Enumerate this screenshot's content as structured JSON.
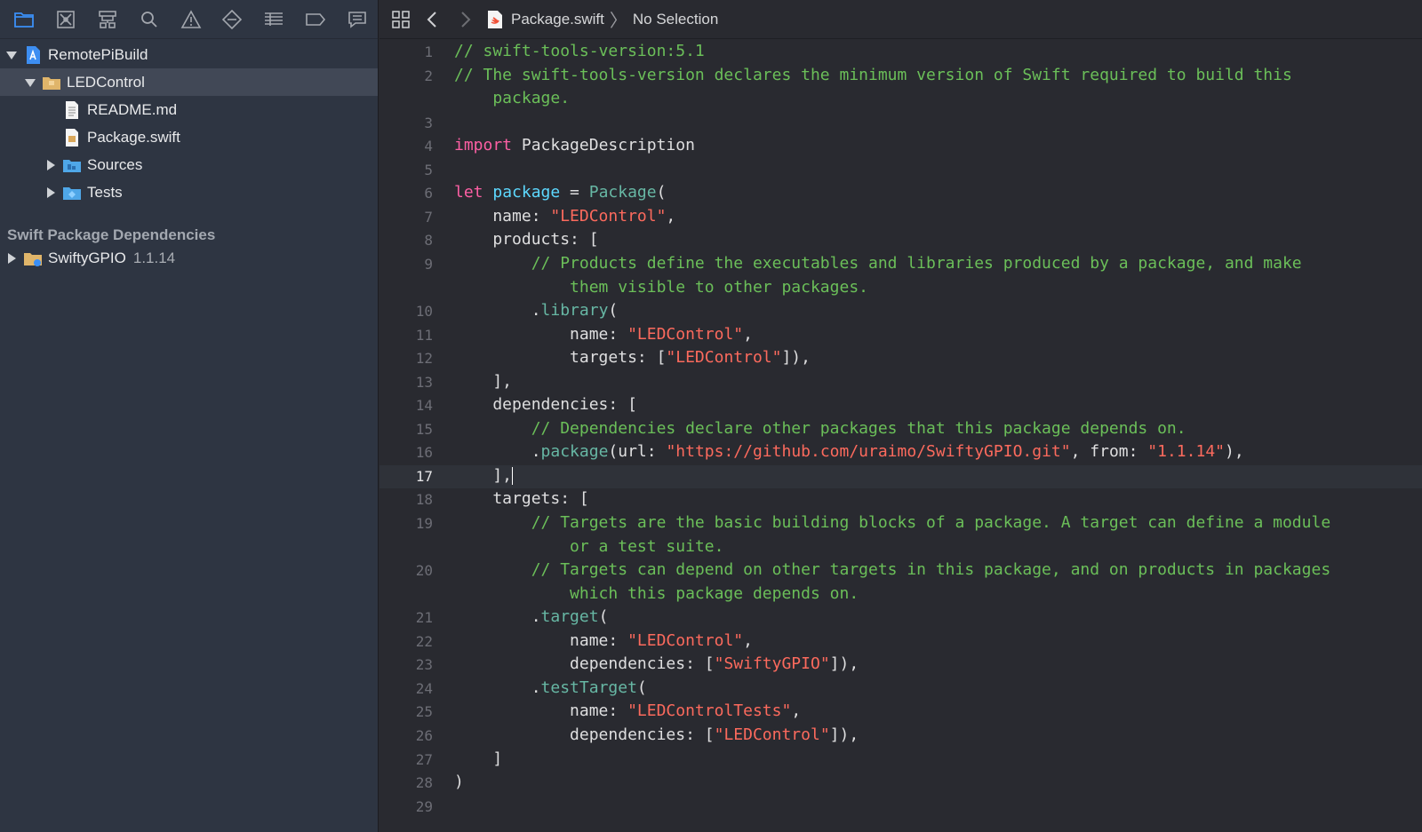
{
  "navigator": {
    "toolbar": [
      {
        "icon": "folder-icon",
        "active": true
      },
      {
        "icon": "source-control-icon"
      },
      {
        "icon": "hierarchy-icon"
      },
      {
        "icon": "search-icon"
      },
      {
        "icon": "warning-icon"
      },
      {
        "icon": "test-diamond-icon"
      },
      {
        "icon": "debug-list-icon"
      },
      {
        "icon": "breakpoint-tag-icon"
      },
      {
        "icon": "report-bubble-icon"
      }
    ],
    "project": "RemotePiBuild",
    "package_folder": "LEDControl",
    "files": [
      "README.md",
      "Package.swift"
    ],
    "folders": [
      "Sources",
      "Tests"
    ],
    "section_header": "Swift Package Dependencies",
    "dependency": {
      "name": "SwiftyGPIO",
      "version": "1.1.14"
    }
  },
  "jump_bar": {
    "file": "Package.swift",
    "selection": "No Selection"
  },
  "editor": {
    "current_line": 17,
    "lines": [
      {
        "n": "1",
        "parts": [
          {
            "c": "t-comment",
            "t": "// swift-tools-version:5.1"
          }
        ]
      },
      {
        "n": "2",
        "parts": [
          {
            "c": "t-comment",
            "t": "// The swift-tools-version declares the minimum version of Swift required to build this"
          }
        ]
      },
      {
        "n": "",
        "parts": [
          {
            "c": "t-comment",
            "t": "    package."
          }
        ]
      },
      {
        "n": "3",
        "parts": []
      },
      {
        "n": "4",
        "parts": [
          {
            "c": "t-keyword",
            "t": "import"
          },
          {
            "c": "",
            "t": " PackageDescription"
          }
        ]
      },
      {
        "n": "5",
        "parts": []
      },
      {
        "n": "6",
        "parts": [
          {
            "c": "t-keyword",
            "t": "let"
          },
          {
            "c": "",
            "t": " "
          },
          {
            "c": "t-decl",
            "t": "package"
          },
          {
            "c": "",
            "t": " = "
          },
          {
            "c": "t-func",
            "t": "Package"
          },
          {
            "c": "",
            "t": "("
          }
        ]
      },
      {
        "n": "7",
        "parts": [
          {
            "c": "",
            "t": "    name: "
          },
          {
            "c": "t-string",
            "t": "\"LEDControl\""
          },
          {
            "c": "",
            "t": ","
          }
        ]
      },
      {
        "n": "8",
        "parts": [
          {
            "c": "",
            "t": "    products: ["
          }
        ]
      },
      {
        "n": "9",
        "parts": [
          {
            "c": "t-comment",
            "t": "        // Products define the executables and libraries produced by a package, and make"
          }
        ]
      },
      {
        "n": "",
        "parts": [
          {
            "c": "t-comment",
            "t": "            them visible to other packages."
          }
        ]
      },
      {
        "n": "10",
        "parts": [
          {
            "c": "",
            "t": "        ."
          },
          {
            "c": "t-func",
            "t": "library"
          },
          {
            "c": "",
            "t": "("
          }
        ]
      },
      {
        "n": "11",
        "parts": [
          {
            "c": "",
            "t": "            name: "
          },
          {
            "c": "t-string",
            "t": "\"LEDControl\""
          },
          {
            "c": "",
            "t": ","
          }
        ]
      },
      {
        "n": "12",
        "parts": [
          {
            "c": "",
            "t": "            targets: ["
          },
          {
            "c": "t-string",
            "t": "\"LEDControl\""
          },
          {
            "c": "",
            "t": "]),"
          }
        ]
      },
      {
        "n": "13",
        "parts": [
          {
            "c": "",
            "t": "    ],"
          }
        ]
      },
      {
        "n": "14",
        "parts": [
          {
            "c": "",
            "t": "    dependencies: ["
          }
        ]
      },
      {
        "n": "15",
        "parts": [
          {
            "c": "t-comment",
            "t": "        // Dependencies declare other packages that this package depends on."
          }
        ]
      },
      {
        "n": "16",
        "parts": [
          {
            "c": "",
            "t": "        ."
          },
          {
            "c": "t-func",
            "t": "package"
          },
          {
            "c": "",
            "t": "(url: "
          },
          {
            "c": "t-string",
            "t": "\"https://github.com/uraimo/SwiftyGPIO.git\""
          },
          {
            "c": "",
            "t": ", from: "
          },
          {
            "c": "t-string",
            "t": "\"1.1.14\""
          },
          {
            "c": "",
            "t": "),"
          }
        ]
      },
      {
        "n": "17",
        "parts": [
          {
            "c": "",
            "t": "    ],"
          }
        ],
        "caret": true
      },
      {
        "n": "18",
        "parts": [
          {
            "c": "",
            "t": "    targets: ["
          }
        ]
      },
      {
        "n": "19",
        "parts": [
          {
            "c": "t-comment",
            "t": "        // Targets are the basic building blocks of a package. A target can define a module"
          }
        ]
      },
      {
        "n": "",
        "parts": [
          {
            "c": "t-comment",
            "t": "            or a test suite."
          }
        ]
      },
      {
        "n": "20",
        "parts": [
          {
            "c": "t-comment",
            "t": "        // Targets can depend on other targets in this package, and on products in packages"
          }
        ]
      },
      {
        "n": "",
        "parts": [
          {
            "c": "t-comment",
            "t": "            which this package depends on."
          }
        ]
      },
      {
        "n": "21",
        "parts": [
          {
            "c": "",
            "t": "        ."
          },
          {
            "c": "t-func",
            "t": "target"
          },
          {
            "c": "",
            "t": "("
          }
        ]
      },
      {
        "n": "22",
        "parts": [
          {
            "c": "",
            "t": "            name: "
          },
          {
            "c": "t-string",
            "t": "\"LEDControl\""
          },
          {
            "c": "",
            "t": ","
          }
        ]
      },
      {
        "n": "23",
        "parts": [
          {
            "c": "",
            "t": "            dependencies: ["
          },
          {
            "c": "t-string",
            "t": "\"SwiftyGPIO\""
          },
          {
            "c": "",
            "t": "]),"
          }
        ]
      },
      {
        "n": "24",
        "parts": [
          {
            "c": "",
            "t": "        ."
          },
          {
            "c": "t-func",
            "t": "testTarget"
          },
          {
            "c": "",
            "t": "("
          }
        ]
      },
      {
        "n": "25",
        "parts": [
          {
            "c": "",
            "t": "            name: "
          },
          {
            "c": "t-string",
            "t": "\"LEDControlTests\""
          },
          {
            "c": "",
            "t": ","
          }
        ]
      },
      {
        "n": "26",
        "parts": [
          {
            "c": "",
            "t": "            dependencies: ["
          },
          {
            "c": "t-string",
            "t": "\"LEDControl\""
          },
          {
            "c": "",
            "t": "]),"
          }
        ]
      },
      {
        "n": "27",
        "parts": [
          {
            "c": "",
            "t": "    ]"
          }
        ]
      },
      {
        "n": "28",
        "parts": [
          {
            "c": "",
            "t": ")"
          }
        ]
      },
      {
        "n": "29",
        "parts": []
      }
    ]
  }
}
